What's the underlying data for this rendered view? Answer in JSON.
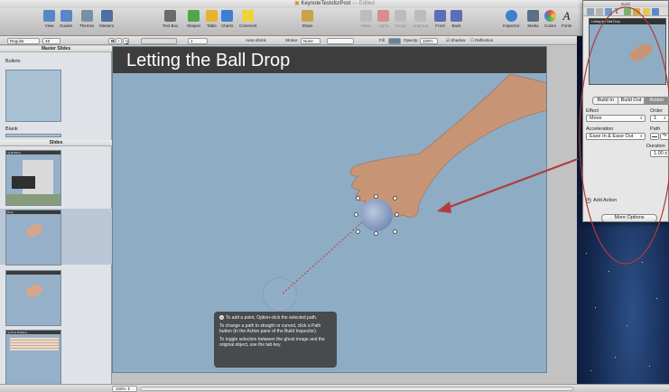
{
  "window": {
    "title": "KeynoteTestsforPost",
    "edited": "— Edited"
  },
  "toolbar": {
    "left": [
      {
        "label": "View",
        "icon": "view-icon",
        "color": "#5a86c8"
      },
      {
        "label": "Guides",
        "icon": "guides-icon",
        "color": "#5a86c8"
      },
      {
        "label": "Themes",
        "icon": "themes-icon",
        "color": "#7b8ea8"
      },
      {
        "label": "Masters",
        "icon": "masters-icon",
        "color": "#4f6ea5"
      }
    ],
    "center": [
      {
        "label": "Text Box",
        "icon": "textbox-icon",
        "color": "#6a6a6a"
      },
      {
        "label": "Shapes",
        "icon": "shapes-icon",
        "color": "#4fa64f"
      },
      {
        "label": "Table",
        "icon": "table-icon",
        "color": "#e5b42f"
      },
      {
        "label": "Charts",
        "icon": "charts-icon",
        "color": "#3c7fd1"
      },
      {
        "label": "Comment",
        "icon": "comment-icon",
        "color": "#f0d33c"
      }
    ],
    "share": {
      "label": "Share",
      "icon": "share-icon",
      "color": "#c9a24a"
    },
    "arrange": [
      {
        "label": "Mask",
        "icon": "mask-icon",
        "color": "#9a9a9a",
        "enabled": false
      },
      {
        "label": "Alpha",
        "icon": "alpha-icon",
        "color": "#d24b4b",
        "enabled": false
      },
      {
        "label": "Group",
        "icon": "group-icon",
        "color": "#9a9a9a",
        "enabled": false
      },
      {
        "label": "Ungroup",
        "icon": "ungroup-icon",
        "color": "#9a9a9a",
        "enabled": false
      },
      {
        "label": "Front",
        "icon": "front-icon",
        "color": "#5b6fb5",
        "enabled": true
      },
      {
        "label": "Back",
        "icon": "back-icon",
        "color": "#5b6fb5",
        "enabled": true
      }
    ],
    "right": [
      {
        "label": "Inspector",
        "icon": "inspector-icon",
        "color": "#3f7fd0"
      },
      {
        "label": "Media",
        "icon": "media-icon",
        "color": "#5c6e88"
      },
      {
        "label": "Colors",
        "icon": "colors-icon",
        "color": "#e0564a"
      },
      {
        "label": "Fonts",
        "icon": "fonts-icon",
        "color": "#333333"
      }
    ]
  },
  "formatbar": {
    "font_style": "Regular",
    "font_size": "48",
    "b": "B",
    "i": "I",
    "u": "U",
    "spacing": "1",
    "autoshrink": "Auto-shrink",
    "stroke_label": "Stroke:",
    "stroke_value": "None",
    "fill_label": "Fill",
    "opacity_label": "Opacity:",
    "opacity_value": "100%",
    "shadow": "Shadow",
    "reflection": "Reflection"
  },
  "sidebar": {
    "master_header": "Master Slides",
    "masters": [
      {
        "label": "Bullets"
      },
      {
        "label": "Blank"
      }
    ],
    "slides_header": "Slides",
    "slides": [
      {
        "title": "ng Building"
      },
      {
        "title": "Drop"
      },
      {
        "title": ""
      },
      {
        "title": "ng New Building"
      }
    ]
  },
  "slide": {
    "title": "Letting the Ball Drop",
    "tooltip": {
      "line1": "To add a point, Option-click the selected path.",
      "line2": "To change a path to straight or curved, click a Path button (in the Action pane of the Build Inspector).",
      "line3": "To toggle selection between the ghost image and the original object, use the tab key."
    }
  },
  "zoom": {
    "value": "100%"
  },
  "inspector": {
    "title": "Build",
    "preview_title": "Letting the Ball Drop",
    "tabs": [
      "Build In",
      "Build Out",
      "Action"
    ],
    "effect_label": "Effect",
    "effect_value": "Move",
    "order_label": "Order",
    "order_value": "1",
    "acceleration_label": "Acceleration",
    "acceleration_value": "Ease In & Ease Out",
    "path_label": "Path",
    "duration_label": "Duration",
    "duration_value": "1.00 s",
    "add_action": "Add Action",
    "more_options": "More Options"
  },
  "annotation": {
    "color": "#b23b3b"
  }
}
